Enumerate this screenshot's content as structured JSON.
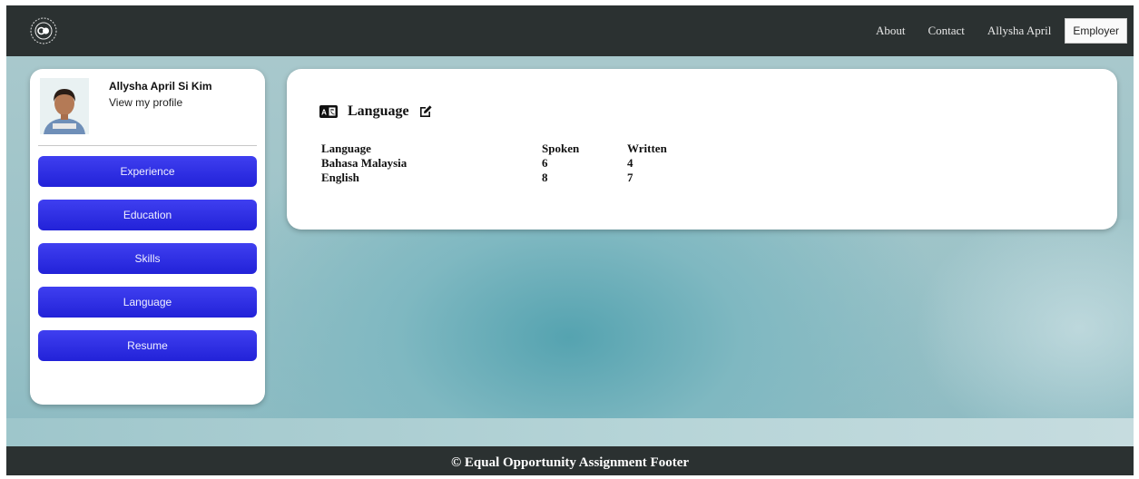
{
  "nav": {
    "logo_icon": "equal-opportunity-logo",
    "links": [
      "About",
      "Contact",
      "Allysha April"
    ],
    "employer_label": "Employer"
  },
  "profile": {
    "name": "Allysha April Si Kim",
    "link": "View my profile"
  },
  "sidebar": {
    "items": [
      {
        "label": "Experience"
      },
      {
        "label": "Education"
      },
      {
        "label": "Skills"
      },
      {
        "label": "Language"
      },
      {
        "label": "Resume"
      }
    ]
  },
  "card": {
    "icon": "language-icon",
    "title": "Language",
    "edit_icon": "edit-icon",
    "columns": [
      "Language",
      "Spoken",
      "Written"
    ],
    "rows": [
      [
        "Bahasa Malaysia",
        "6",
        "4"
      ],
      [
        "English",
        "8",
        "7"
      ]
    ]
  },
  "footer": {
    "text": "© Equal Opportunity Assignment Footer"
  },
  "colors": {
    "navbar": "#2b3131",
    "button": "#2a2ae0",
    "background": "#9cc3c8"
  }
}
